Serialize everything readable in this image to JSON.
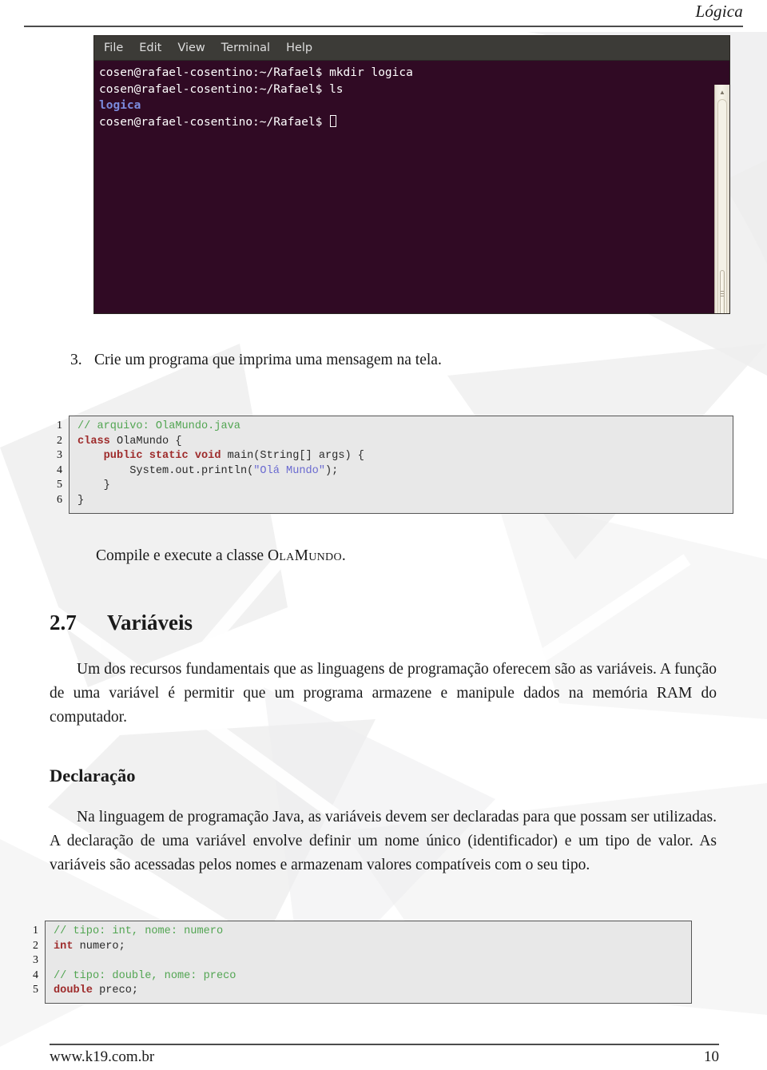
{
  "header": {
    "running_head": "Lógica"
  },
  "terminal": {
    "window_name": "gnome-terminal",
    "menubar": [
      "File",
      "Edit",
      "View",
      "Terminal",
      "Help"
    ],
    "lines": [
      {
        "text": "cosen@rafael-cosentino:~/Rafael$ mkdir logica",
        "style": "normal"
      },
      {
        "text": "cosen@rafael-cosentino:~/Rafael$ ls",
        "style": "normal"
      },
      {
        "text": "logica",
        "style": "dir"
      },
      {
        "text": "cosen@rafael-cosentino:~/Rafael$ ",
        "style": "prompt-cursor"
      }
    ],
    "scrollbar": {
      "up_arrow": "▲",
      "down_arrow": "▼"
    },
    "colors": {
      "background": "#300a24",
      "menubar": "#3c3b37",
      "directory": "#7b8cde"
    }
  },
  "exercise": {
    "number": "3.",
    "text": "Crie um programa que imprima uma mensagem na tela."
  },
  "code_olamundo": {
    "line_numbers": [
      "1",
      "2",
      "3",
      "4",
      "5",
      "6"
    ],
    "lines": [
      [
        {
          "t": "// arquivo: OlaMundo.java",
          "c": "comment"
        }
      ],
      [
        {
          "t": "class",
          "c": "keyword"
        },
        {
          "t": " OlaMundo {",
          "c": "plain"
        }
      ],
      [
        {
          "t": "    ",
          "c": "plain"
        },
        {
          "t": "public static void",
          "c": "keyword"
        },
        {
          "t": " main(String[] args) {",
          "c": "plain"
        }
      ],
      [
        {
          "t": "        System.out.println(",
          "c": "plain"
        },
        {
          "t": "\"Olá Mundo\"",
          "c": "string"
        },
        {
          "t": ");",
          "c": "plain"
        }
      ],
      [
        {
          "t": "    }",
          "c": "plain"
        }
      ],
      [
        {
          "t": "}",
          "c": "plain"
        }
      ]
    ]
  },
  "compile_line": {
    "before": "Compile e execute a classe ",
    "classname": "OlaMundo",
    "after": "."
  },
  "section": {
    "number": "2.7",
    "title": "Variáveis",
    "paragraph": "Um dos recursos fundamentais que as linguagens de programação oferecem são as variáveis. A função de uma variável é permitir que um programa armazene e manipule dados na memória RAM do computador."
  },
  "subsection": {
    "title": "Declaração",
    "paragraph": "Na linguagem de programação Java, as variáveis devem ser declaradas para que possam ser utilizadas. A declaração de uma variável envolve definir um nome único (identificador) e um tipo de valor. As variáveis são acessadas pelos nomes e armazenam valores compatíveis com o seu tipo."
  },
  "code_declaracao": {
    "line_numbers": [
      "1",
      "2",
      "3",
      "4",
      "5"
    ],
    "lines": [
      [
        {
          "t": "// tipo: int, nome: numero",
          "c": "comment"
        }
      ],
      [
        {
          "t": "int",
          "c": "keyword"
        },
        {
          "t": " numero;",
          "c": "plain"
        }
      ],
      [
        {
          "t": "",
          "c": "plain"
        }
      ],
      [
        {
          "t": "// tipo: double, nome: preco",
          "c": "comment"
        }
      ],
      [
        {
          "t": "double",
          "c": "keyword"
        },
        {
          "t": " preco;",
          "c": "plain"
        }
      ]
    ]
  },
  "footer": {
    "site": "www.k19.com.br",
    "page_number": "10"
  },
  "colors": {
    "rule": "#4c4c4c",
    "code_background": "#e8e8e8",
    "code_border": "#565656",
    "comment": "#52a552",
    "keyword": "#9e2b2b",
    "string": "#6a6ad0",
    "watermark": "#eceded"
  }
}
